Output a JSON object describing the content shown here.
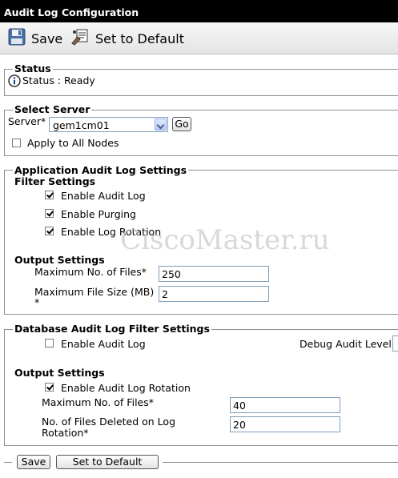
{
  "window": {
    "title": "Audit Log Configuration"
  },
  "toolbar": {
    "save_label": "Save",
    "default_label": "Set to Default"
  },
  "status": {
    "legend": "Status",
    "text": "Status : Ready"
  },
  "select_server": {
    "legend": "Select Server",
    "server_label": "Server*",
    "server_value": "gem1cm01",
    "go_label": "Go",
    "apply_all_label": "Apply to All Nodes",
    "apply_all_checked": false
  },
  "app_audit": {
    "legend": "Application Audit Log Settings",
    "filter_title": "Filter Settings",
    "enable_audit_label": "Enable Audit Log",
    "enable_audit_checked": true,
    "enable_purging_label": "Enable Purging",
    "enable_purging_checked": true,
    "enable_rotation_label": "Enable Log Rotation",
    "enable_rotation_checked": true,
    "output_title": "Output Settings",
    "max_files_label": "Maximum No. of Files*",
    "max_files_value": "250",
    "max_size_label": "Maximum File Size (MB)",
    "max_size_asterisk": "*",
    "max_size_value": "2"
  },
  "db_audit": {
    "legend": "Database Audit Log Filter Settings",
    "enable_audit_label": "Enable Audit Log",
    "enable_audit_checked": false,
    "debug_level_label": "Debug Audit Level",
    "output_title": "Output Settings",
    "enable_rotation_label": "Enable Audit Log Rotation",
    "enable_rotation_checked": true,
    "max_files_label": "Maximum No. of Files*",
    "max_files_value": "40",
    "deleted_label_1": "No. of Files Deleted on Log",
    "deleted_label_2": "Rotation*",
    "deleted_value": "20"
  },
  "footer": {
    "save_label": "Save",
    "default_label": "Set to Default"
  },
  "watermark": "CiscoMaster.ru"
}
